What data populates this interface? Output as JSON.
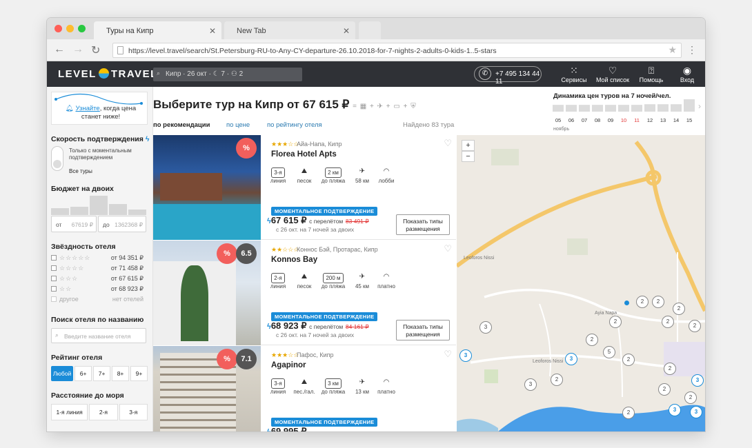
{
  "browser": {
    "tabs": [
      {
        "label": "Туры на Кипр"
      },
      {
        "label": "New Tab"
      }
    ],
    "url": "https://level.travel/search/St.Petersburg-RU-to-Any-CY-departure-26.10.2018-for-7-nights-2-adults-0-kids-1..5-stars"
  },
  "header": {
    "logo_left": "LEVEL",
    "logo_right": "TRAVEL",
    "search_summary": "Кипр · 26 окт · ☾ 7 · ⚇ 2",
    "phone": "+7 495 134 44 11",
    "nav": [
      {
        "label": "Сервисы",
        "icon": "grid-icon"
      },
      {
        "label": "Мой список",
        "icon": "heart-icon"
      },
      {
        "label": "Помощь",
        "icon": "help-icon"
      },
      {
        "label": "Вход",
        "icon": "user-icon"
      }
    ]
  },
  "sidebar": {
    "promo": {
      "link": "Узнайте",
      "rest": ", когда цена станет ниже!"
    },
    "confirm_title": "Скорость подтверждения",
    "confirm_options": [
      "Только с моментальным подтверждением",
      "Все туры"
    ],
    "budget_title": "Бюджет на двоих",
    "budget_from_label": "от",
    "budget_from": "67619 ₽",
    "budget_to_label": "до",
    "budget_to": "1362368 ₽",
    "stars_title": "Звёздность отеля",
    "stars": [
      {
        "stars": "☆☆☆☆☆",
        "price": "от 94 351 ₽"
      },
      {
        "stars": "☆☆☆☆",
        "price": "от 71 458 ₽"
      },
      {
        "stars": "☆☆☆",
        "price": "от 67 615 ₽"
      },
      {
        "stars": "☆☆",
        "price": "от 68 923 ₽"
      },
      {
        "stars": "другое",
        "price": "нет отелей"
      }
    ],
    "name_search_title": "Поиск отеля по названию",
    "name_search_placeholder": "Введите название отеля",
    "rating_title": "Рейтинг отеля",
    "rating_options": [
      "Любой",
      "6+",
      "7+",
      "8+",
      "9+"
    ],
    "sea_title": "Расстояние до моря",
    "sea_options": [
      "1-я линия",
      "2-я",
      "3-я"
    ]
  },
  "main": {
    "title": "Выберите тур на Кипр от 67 615 ₽",
    "sort": [
      "по рекомендации",
      "по цене",
      "по рейтингу отеля"
    ],
    "found": "Найдено 83 тура",
    "hotels": [
      {
        "stars": "★★★☆☆",
        "location": "Айа-Напа, Кипр",
        "name": "Florea Hotel Apts",
        "badge": "%",
        "rating": "",
        "amenities": [
          {
            "icon": "3-я",
            "label": "линия"
          },
          {
            "icon": "sand-icon",
            "label": "песок"
          },
          {
            "icon": "2 км",
            "label": "до пляжа"
          },
          {
            "icon": "plane-icon",
            "label": "58 км"
          },
          {
            "icon": "wifi-icon",
            "label": "лобби"
          }
        ],
        "instant": "МОМЕНТАЛЬНОЕ ПОДТВЕРЖДЕНИЕ",
        "price": "67 615 ₽",
        "with_flight": "с перелётом",
        "old_price": "83 491 ₽",
        "dates": "с 26 окт. на 7 ночей за двоих",
        "button": "Показать типы размещения"
      },
      {
        "stars": "★★☆☆☆",
        "location": "Коннос Бэй, Протарас, Кипр",
        "name": "Konnos Bay",
        "badge": "%",
        "rating": "6.5",
        "amenities": [
          {
            "icon": "2-я",
            "label": "линия"
          },
          {
            "icon": "sand-icon",
            "label": "песок"
          },
          {
            "icon": "200 м",
            "label": "до пляжа"
          },
          {
            "icon": "plane-icon",
            "label": "45 км"
          },
          {
            "icon": "wifi-icon",
            "label": "платно"
          }
        ],
        "instant": "МОМЕНТАЛЬНОЕ ПОДТВЕРЖДЕНИЕ",
        "price": "68 923 ₽",
        "with_flight": "с перелётом",
        "old_price": "84 161 ₽",
        "dates": "с 26 окт. на 7 ночей за двоих",
        "button": "Показать типы размещения"
      },
      {
        "stars": "★★★☆☆",
        "location": "Пафос, Кипр",
        "name": "Agapinor",
        "badge": "%",
        "rating": "7.1",
        "amenities": [
          {
            "icon": "3-я",
            "label": "линия"
          },
          {
            "icon": "pebble-icon",
            "label": "пес./гал."
          },
          {
            "icon": "3 км",
            "label": "до пляжа"
          },
          {
            "icon": "plane-icon",
            "label": "13 км"
          },
          {
            "icon": "wifi-icon",
            "label": "платно"
          }
        ],
        "instant": "МОМЕНТАЛЬНОЕ ПОДТВЕРЖДЕНИЕ",
        "price": "69 995 ₽"
      }
    ]
  },
  "price_dynamics": {
    "title": "Динамика цен туров на 7 ночей/чел.",
    "month": "ноябрь",
    "chart_data": {
      "type": "bar",
      "categories": [
        "05",
        "06",
        "07",
        "08",
        "09",
        "10",
        "11",
        "12",
        "13",
        "14",
        "15"
      ],
      "highlighted": [
        "10",
        "11"
      ],
      "values": [
        0.55,
        0.55,
        0.55,
        0.55,
        0.55,
        0.55,
        0.55,
        0.6,
        0.6,
        0.6,
        1.0
      ]
    }
  },
  "map": {
    "clusters": [
      "2",
      "2",
      "2",
      "2",
      "3",
      "2",
      "2",
      "2",
      "5",
      "2",
      "2",
      "3",
      "2",
      "3",
      "3",
      "2",
      "3",
      "3",
      "2",
      "2",
      "3"
    ]
  }
}
